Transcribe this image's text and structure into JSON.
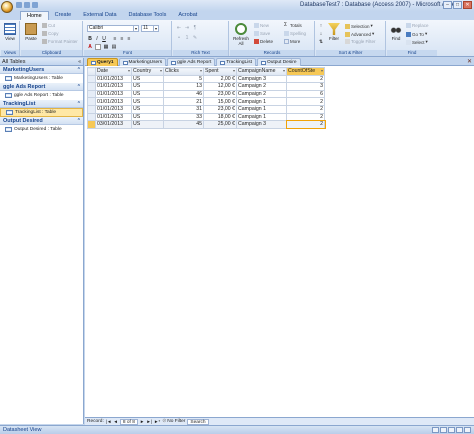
{
  "window": {
    "title": "DatabaseTest7 : Database (Access 2007) - Microsoft Access",
    "controls": {
      "minimize": "–",
      "maximize": "□",
      "close": "✕"
    }
  },
  "ribbon_tabs": [
    "Home",
    "Create",
    "External Data",
    "Database Tools",
    "Acrobat"
  ],
  "active_tab": "Home",
  "ribbon": {
    "views": {
      "view_label": "View",
      "group_label": "Views"
    },
    "clipboard": {
      "paste_label": "Paste",
      "cut_label": "Cut",
      "copy_label": "Copy",
      "format_painter_label": "Format Painter",
      "group_label": "Clipboard"
    },
    "font": {
      "font_name": "Calibri",
      "font_size": "11",
      "bold": "B",
      "italic": "I",
      "underline": "U",
      "group_label": "Font"
    },
    "rich_text": {
      "group_label": "Rich Text"
    },
    "records": {
      "refresh_label": "Refresh All",
      "new_label": "New",
      "save_label": "Save",
      "delete_label": "Delete",
      "totals_label": "Totals",
      "spelling_label": "Spelling",
      "more_label": "More",
      "group_label": "Records"
    },
    "sort_filter": {
      "filter_label": "Filter",
      "selection_label": "Selection",
      "advanced_label": "Advanced",
      "toggle_filter_label": "Toggle Filter",
      "group_label": "Sort & Filter"
    },
    "find": {
      "find_label": "Find",
      "replace_label": "Replace",
      "goto_label": "Go To",
      "select_label": "Select",
      "group_label": "Find"
    }
  },
  "nav_pane": {
    "header": "All Tables",
    "groups": [
      {
        "name": "MarketingUsers",
        "items": [
          {
            "label": "MarketingUsers : Table",
            "selected": false
          }
        ]
      },
      {
        "name": "ggle Ads Report",
        "items": [
          {
            "label": "ggle Ads Report : Table",
            "selected": false
          }
        ]
      },
      {
        "name": "TrackingList",
        "items": [
          {
            "label": "TrackingList : Table",
            "selected": true
          }
        ]
      },
      {
        "name": "Output Desired",
        "items": [
          {
            "label": "Output Desired : Table",
            "selected": false
          }
        ]
      }
    ]
  },
  "doc_tabs": [
    {
      "label": "Query1",
      "active": true
    },
    {
      "label": "MarketingUsers",
      "active": false
    },
    {
      "label": "ggle Ads Report",
      "active": false
    },
    {
      "label": "TrackingList",
      "active": false
    },
    {
      "label": "Output Desire",
      "active": false
    }
  ],
  "datasheet": {
    "columns": [
      "Date",
      "Country",
      "Clicks",
      "Spent",
      "CampaignName",
      "CountOfSte"
    ],
    "rows": [
      [
        "01/01/2013",
        "US",
        "5",
        "2,00 €",
        "Campaign 3",
        "2"
      ],
      [
        "01/01/2013",
        "US",
        "13",
        "12,00 €",
        "Campaign 2",
        "3"
      ],
      [
        "01/01/2013",
        "US",
        "46",
        "23,00 €",
        "Campaign 2",
        "6"
      ],
      [
        "01/01/2013",
        "US",
        "21",
        "15,00 €",
        "Campaign 1",
        "2"
      ],
      [
        "01/01/2013",
        "US",
        "31",
        "23,00 €",
        "Campaign 1",
        "2"
      ],
      [
        "01/01/2013",
        "US",
        "33",
        "18,00 €",
        "Campaign 1",
        "2"
      ],
      [
        "03/01/2013",
        "US",
        "45",
        "25,00 €",
        "Campaign 3",
        "2"
      ]
    ],
    "current_row": 6
  },
  "record_nav": {
    "record_label": "Record:",
    "position": "8 of 8",
    "first": "|◄",
    "prev": "◄",
    "next": "►",
    "last": "►|",
    "new": "►*",
    "filter_status": "No Filter",
    "search_label": "Search"
  },
  "status_bar": {
    "text": "Datasheet View"
  }
}
